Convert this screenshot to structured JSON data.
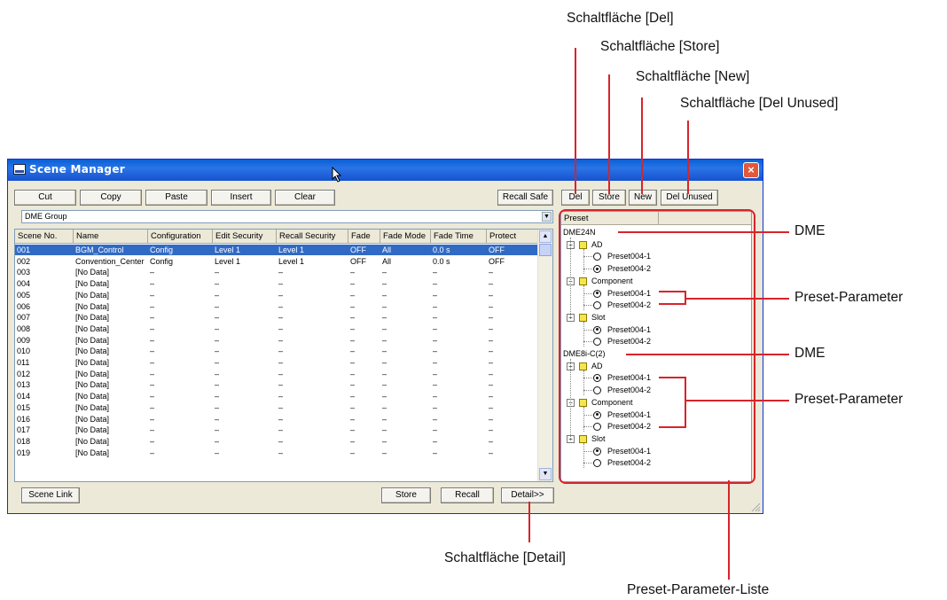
{
  "window": {
    "title": "Scene Manager",
    "close_glyph": "×",
    "colors": {
      "titlebar": "#1652cf",
      "selection": "#316ac5",
      "callout": "#d8242a"
    }
  },
  "toolbar": {
    "cut": "Cut",
    "copy": "Copy",
    "paste": "Paste",
    "insert": "Insert",
    "clear": "Clear",
    "recall_safe": "Recall Safe",
    "del": "Del",
    "store": "Store",
    "new": "New",
    "del_unused": "Del Unused"
  },
  "group_select": {
    "value": "DME Group"
  },
  "scene_table": {
    "columns": [
      "Scene No.",
      "Name",
      "Configuration",
      "Edit Security",
      "Recall Security",
      "Fade",
      "Fade Mode",
      "Fade Time",
      "Protect"
    ],
    "rows": [
      [
        "001",
        "BGM_Control",
        "Config",
        "Level 1",
        "Level 1",
        "OFF",
        "All",
        "0.0 s",
        "OFF"
      ],
      [
        "002",
        "Convention_Center",
        "Config",
        "Level 1",
        "Level 1",
        "OFF",
        "All",
        "0.0 s",
        "OFF"
      ],
      [
        "003",
        "[No Data]",
        "–",
        "–",
        "–",
        "–",
        "–",
        "–",
        "–"
      ],
      [
        "004",
        "[No Data]",
        "–",
        "–",
        "–",
        "–",
        "–",
        "–",
        "–"
      ],
      [
        "005",
        "[No Data]",
        "–",
        "–",
        "–",
        "–",
        "–",
        "–",
        "–"
      ],
      [
        "006",
        "[No Data]",
        "–",
        "–",
        "–",
        "–",
        "–",
        "–",
        "–"
      ],
      [
        "007",
        "[No Data]",
        "–",
        "–",
        "–",
        "–",
        "–",
        "–",
        "–"
      ],
      [
        "008",
        "[No Data]",
        "–",
        "–",
        "–",
        "–",
        "–",
        "–",
        "–"
      ],
      [
        "009",
        "[No Data]",
        "–",
        "–",
        "–",
        "–",
        "–",
        "–",
        "–"
      ],
      [
        "010",
        "[No Data]",
        "–",
        "–",
        "–",
        "–",
        "–",
        "–",
        "–"
      ],
      [
        "011",
        "[No Data]",
        "–",
        "–",
        "–",
        "–",
        "–",
        "–",
        "–"
      ],
      [
        "012",
        "[No Data]",
        "–",
        "–",
        "–",
        "–",
        "–",
        "–",
        "–"
      ],
      [
        "013",
        "[No Data]",
        "–",
        "–",
        "–",
        "–",
        "–",
        "–",
        "–"
      ],
      [
        "014",
        "[No Data]",
        "–",
        "–",
        "–",
        "–",
        "–",
        "–",
        "–"
      ],
      [
        "015",
        "[No Data]",
        "–",
        "–",
        "–",
        "–",
        "–",
        "–",
        "–"
      ],
      [
        "016",
        "[No Data]",
        "–",
        "–",
        "–",
        "–",
        "–",
        "–",
        "–"
      ],
      [
        "017",
        "[No Data]",
        "–",
        "–",
        "–",
        "–",
        "–",
        "–",
        "–"
      ],
      [
        "018",
        "[No Data]",
        "–",
        "–",
        "–",
        "–",
        "–",
        "–",
        "–"
      ],
      [
        "019",
        "[No Data]",
        "–",
        "–",
        "–",
        "–",
        "–",
        "–",
        "–"
      ]
    ],
    "selected_row": 0
  },
  "bottom_bar": {
    "scene_link": "Scene Link",
    "store": "Store",
    "recall": "Recall",
    "detail": "Detail>>"
  },
  "preset_list": {
    "header": "Preset",
    "devices": [
      {
        "name": "DME24N",
        "groups": [
          {
            "name": "AD",
            "presets": [
              {
                "name": "Preset004-1",
                "selected": false
              },
              {
                "name": "Preset004-2",
                "selected": true
              }
            ]
          },
          {
            "name": "Component",
            "presets": [
              {
                "name": "Preset004-1",
                "selected": true
              },
              {
                "name": "Preset004-2",
                "selected": false
              }
            ]
          },
          {
            "name": "Slot",
            "presets": [
              {
                "name": "Preset004-1",
                "selected": true
              },
              {
                "name": "Preset004-2",
                "selected": false
              }
            ]
          }
        ]
      },
      {
        "name": "DME8i-C(2)",
        "groups": [
          {
            "name": "AD",
            "presets": [
              {
                "name": "Preset004-1",
                "selected": true
              },
              {
                "name": "Preset004-2",
                "selected": false
              }
            ]
          },
          {
            "name": "Component",
            "presets": [
              {
                "name": "Preset004-1",
                "selected": true
              },
              {
                "name": "Preset004-2",
                "selected": false
              }
            ]
          },
          {
            "name": "Slot",
            "presets": [
              {
                "name": "Preset004-1",
                "selected": true
              },
              {
                "name": "Preset004-2",
                "selected": false
              }
            ]
          }
        ]
      }
    ]
  },
  "annotations": {
    "del": "Schaltfläche [Del]",
    "store": "Schaltfläche [Store]",
    "new": "Schaltfläche [New]",
    "del_unused": "Schaltfläche [Del Unused]",
    "dme_1": "DME",
    "preset_param_1": "Preset-Parameter",
    "dme_2": "DME",
    "preset_param_2": "Preset-Parameter",
    "detail": "Schaltfläche [Detail]",
    "preset_list": "Preset-Parameter-Liste"
  }
}
